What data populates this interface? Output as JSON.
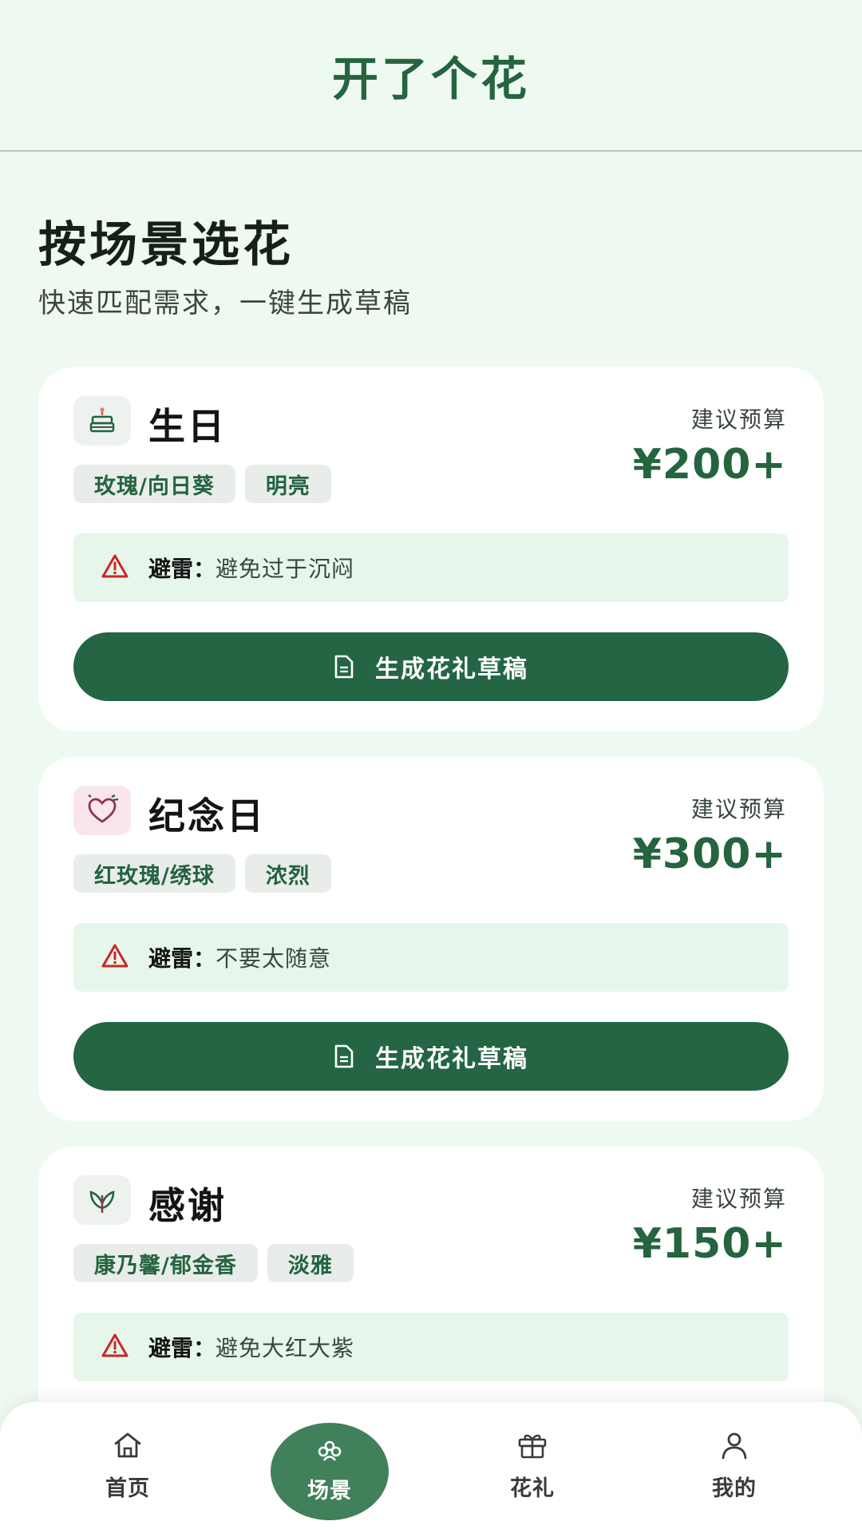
{
  "header": {
    "title": "开了个花"
  },
  "page": {
    "heading": "按场景选花",
    "subtitle": "快速匹配需求，一键生成草稿"
  },
  "cards": [
    {
      "title": "生日",
      "icon": "cake-icon",
      "tags": [
        "玫瑰/向日葵",
        "明亮"
      ],
      "budget_label": "建议预算",
      "budget": "¥200+",
      "warn_label": "避雷：",
      "warn_text": "避免过于沉闷",
      "button": "生成花礼草稿"
    },
    {
      "title": "纪念日",
      "icon": "heart-icon",
      "tags": [
        "红玫瑰/绣球",
        "浓烈"
      ],
      "budget_label": "建议预算",
      "budget": "¥300+",
      "warn_label": "避雷：",
      "warn_text": "不要太随意",
      "button": "生成花礼草稿"
    },
    {
      "title": "感谢",
      "icon": "tulip-icon",
      "tags": [
        "康乃馨/郁金香",
        "淡雅"
      ],
      "budget_label": "建议预算",
      "budget": "¥150+",
      "warn_label": "避雷：",
      "warn_text": "避免大红大紫"
    }
  ],
  "nav": {
    "items": [
      {
        "label": "首页",
        "icon": "home-icon"
      },
      {
        "label": "场景",
        "icon": "flower-icon",
        "active": true
      },
      {
        "label": "花礼",
        "icon": "gift-icon"
      },
      {
        "label": "我的",
        "icon": "user-icon"
      }
    ]
  },
  "colors": {
    "brand": "#24643f",
    "button": "#246544",
    "background": "#eefaf1",
    "warning": "#c62828"
  }
}
